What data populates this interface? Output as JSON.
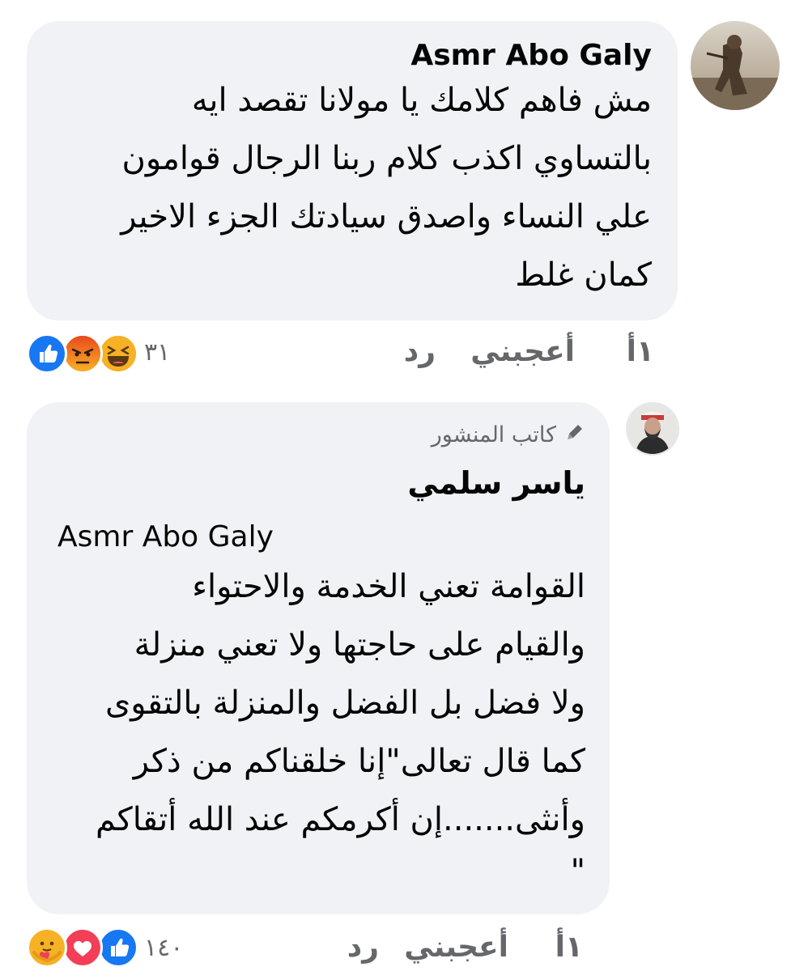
{
  "comments": [
    {
      "author": "Asmr Abo Galy",
      "lines": [
        "مش فاهم كلامك يا مولانا تقصد ايه",
        "بالتساوي اكذب كلام ربنا الرجال قوامون",
        "علي النساء واصدق سيادتك الجزء الاخير",
        "كمان غلط"
      ],
      "time": "١أ",
      "like_label": "أعجبني",
      "reply_label": "رد",
      "reaction_count": "٣١",
      "reactions": [
        "haha-icon",
        "angry-icon",
        "like-icon"
      ]
    },
    {
      "badge": "كاتب المنشور",
      "author": "ياسر سلمي",
      "mention": "Asmr Abo Galy",
      "lines": [
        "القوامة تعني الخدمة والاحتواء",
        "والقيام على حاجتها ولا تعني منزلة",
        "ولا فضل بل الفضل والمنزلة بالتقوى",
        "كما قال تعالى\"إنا خلقناكم من ذكر",
        "وأنثى.......إن أكرمكم عند الله أتقاكم",
        "\""
      ],
      "time": "١أ",
      "like_label": "أعجبني",
      "reply_label": "رد",
      "reaction_count": "١٤٠",
      "reactions": [
        "like-icon",
        "love-icon",
        "care-icon"
      ]
    }
  ],
  "colors": {
    "bubble": "#f0f2f5",
    "like": "#1877f2",
    "love": "#f33e58",
    "reaction_yellow": "#f7b125",
    "angry": "#e9710f",
    "meta_text": "#65676b"
  }
}
